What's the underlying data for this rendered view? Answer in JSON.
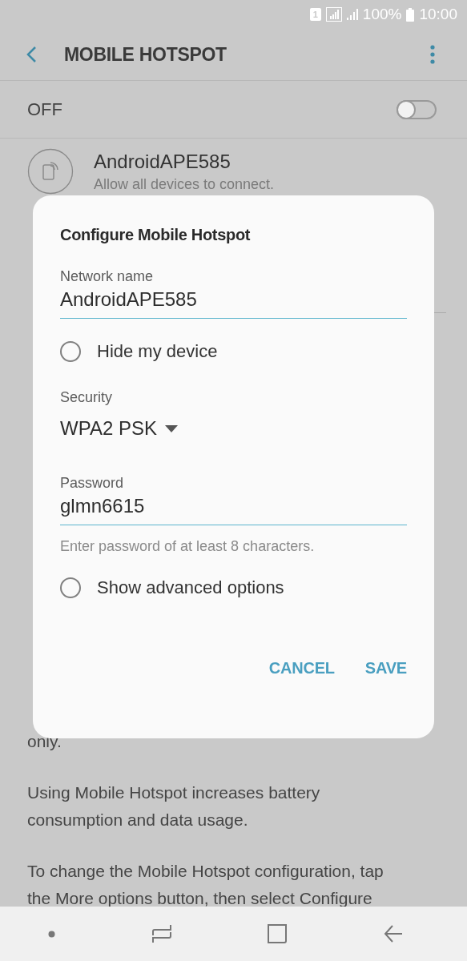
{
  "status_bar": {
    "sim": "1",
    "battery": "100%",
    "time": "10:00"
  },
  "app_bar": {
    "title": "MOBILE HOTSPOT"
  },
  "master_switch": {
    "label": "OFF",
    "on": false
  },
  "hotspot": {
    "name": "AndroidAPE585",
    "subtitle": "Allow all devices to connect."
  },
  "paragraphs": [
    {
      "lines": [
        "only."
      ]
    },
    {
      "lines": [
        "Using Mobile Hotspot increases battery",
        "consumption and data usage."
      ]
    },
    {
      "lines": [
        "To change the Mobile Hotspot configuration, tap",
        "the More options button, then select Configure"
      ]
    }
  ],
  "dialog": {
    "title": "Configure Mobile Hotspot",
    "fields": [
      {
        "kind": "text",
        "label": "Network name",
        "value": "AndroidAPE585"
      },
      {
        "kind": "radio",
        "label": "Hide my device",
        "checked": false
      },
      {
        "kind": "dropdown",
        "label": "Security",
        "value": "WPA2 PSK"
      },
      {
        "kind": "text",
        "label": "Password",
        "value": "glmn6615",
        "hint": "Enter password of at least 8 characters."
      },
      {
        "kind": "radio",
        "label": "Show advanced options",
        "checked": false
      }
    ],
    "buttons": [
      "CANCEL",
      "SAVE"
    ]
  }
}
